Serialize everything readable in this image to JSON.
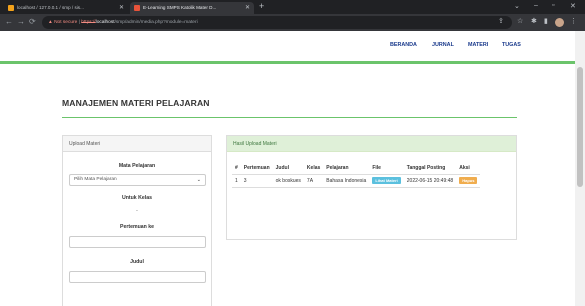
{
  "browser": {
    "tabs": [
      {
        "label": "localhost / 127.0.0.1 / smp / sis..."
      },
      {
        "label": "E-Learning SMPS Katolik Mater D..."
      }
    ],
    "new_tab": "+",
    "url": {
      "warning": "Not secure",
      "scheme": "https://",
      "host": "localhost",
      "path": "/smp/admin/media.php?module=materi"
    }
  },
  "nav": {
    "items": [
      {
        "label": "BERANDA"
      },
      {
        "label": "JURNAL"
      },
      {
        "label": "MATERI"
      },
      {
        "label": "TUGAS"
      }
    ]
  },
  "page": {
    "title": "MANAJEMEN MATERI PELAJARAN"
  },
  "upload": {
    "heading": "Upload Materi",
    "mapel_label": "Mata Pelajaran",
    "mapel_select": "Pilih Mata Pelajaran",
    "kelas_label": "Untuk Kelas",
    "kelas_value": "-",
    "pertemuan_label": "Pertemuan ke",
    "judul_label": "Judul"
  },
  "result": {
    "heading": "Hasil Upload Materi",
    "columns": [
      "#",
      "Pertemuan",
      "Judul",
      "Kelas",
      "Pelajaran",
      "File",
      "Tanggal Posting",
      "Aksi"
    ],
    "rows": [
      {
        "no": "1",
        "pertemuan": "3",
        "judul": "ok boskues",
        "kelas": "7A",
        "pelajaran": "Bahasa Indonesia",
        "file": "Lihat Materi",
        "tanggal": "2022-06-15 20:49:48",
        "aksi": "Hapus"
      }
    ]
  },
  "colors": {
    "accent_green": "#6bc46b",
    "nav_blue": "#1a3a8c",
    "info": "#5bc0de",
    "warning": "#f0ad4e"
  }
}
